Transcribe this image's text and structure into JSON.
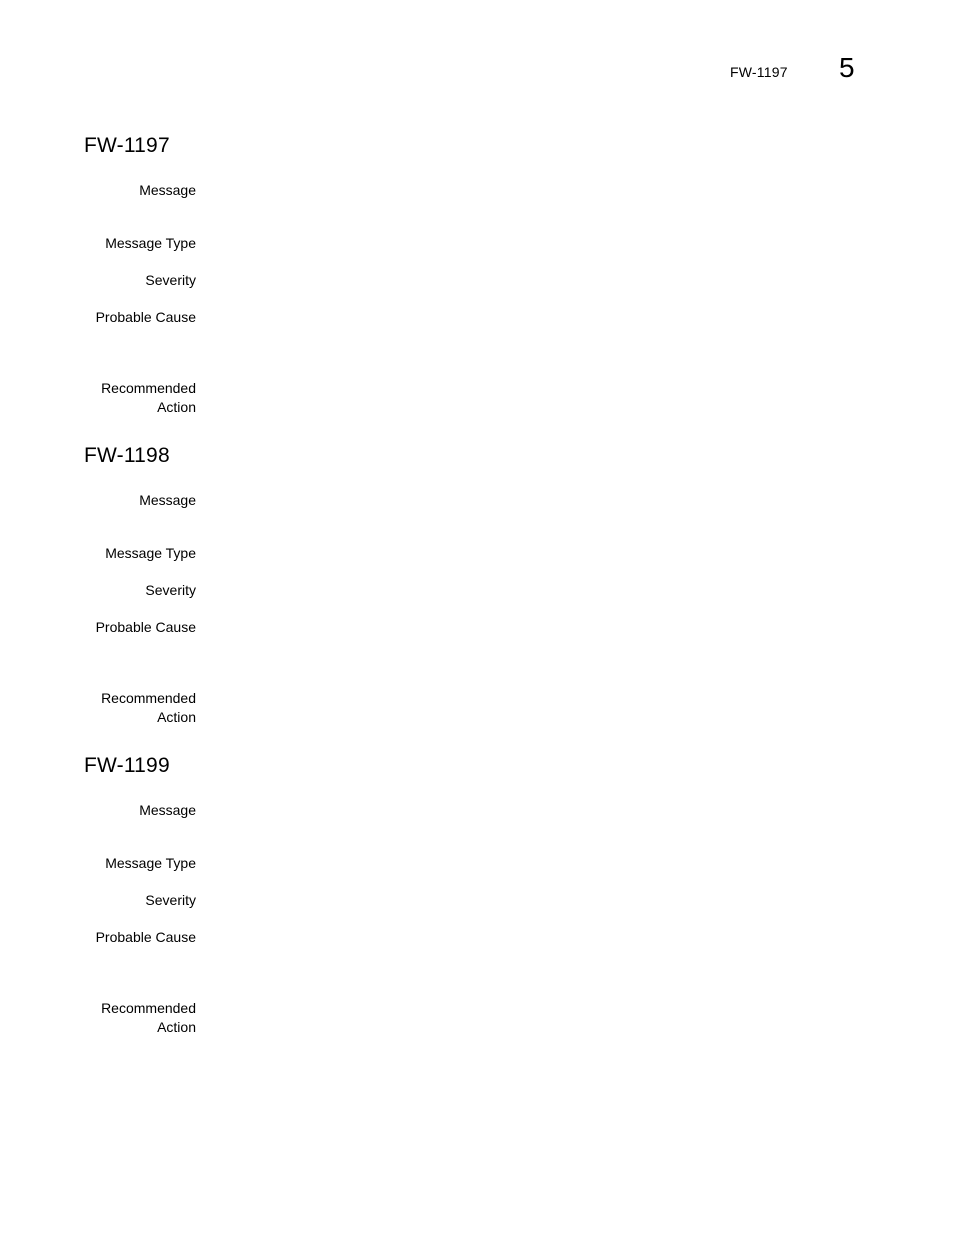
{
  "header": {
    "running_title": "FW-1197",
    "chapter_number": "5"
  },
  "sections": [
    {
      "title": "FW-1197",
      "fields": [
        {
          "label": "Message",
          "value": ""
        },
        {
          "label": "Message Type",
          "value": ""
        },
        {
          "label": "Severity",
          "value": ""
        },
        {
          "label": "Probable Cause",
          "value": ""
        },
        {
          "label_line1": "Recommended",
          "label_line2": "Action",
          "value": ""
        }
      ]
    },
    {
      "title": "FW-1198",
      "fields": [
        {
          "label": "Message",
          "value": ""
        },
        {
          "label": "Message Type",
          "value": ""
        },
        {
          "label": "Severity",
          "value": ""
        },
        {
          "label": "Probable Cause",
          "value": ""
        },
        {
          "label_line1": "Recommended",
          "label_line2": "Action",
          "value": ""
        }
      ]
    },
    {
      "title": "FW-1199",
      "fields": [
        {
          "label": "Message",
          "value": ""
        },
        {
          "label": "Message Type",
          "value": ""
        },
        {
          "label": "Severity",
          "value": ""
        },
        {
          "label": "Probable Cause",
          "value": ""
        },
        {
          "label_line1": "Recommended",
          "label_line2": "Action",
          "value": ""
        }
      ]
    }
  ]
}
